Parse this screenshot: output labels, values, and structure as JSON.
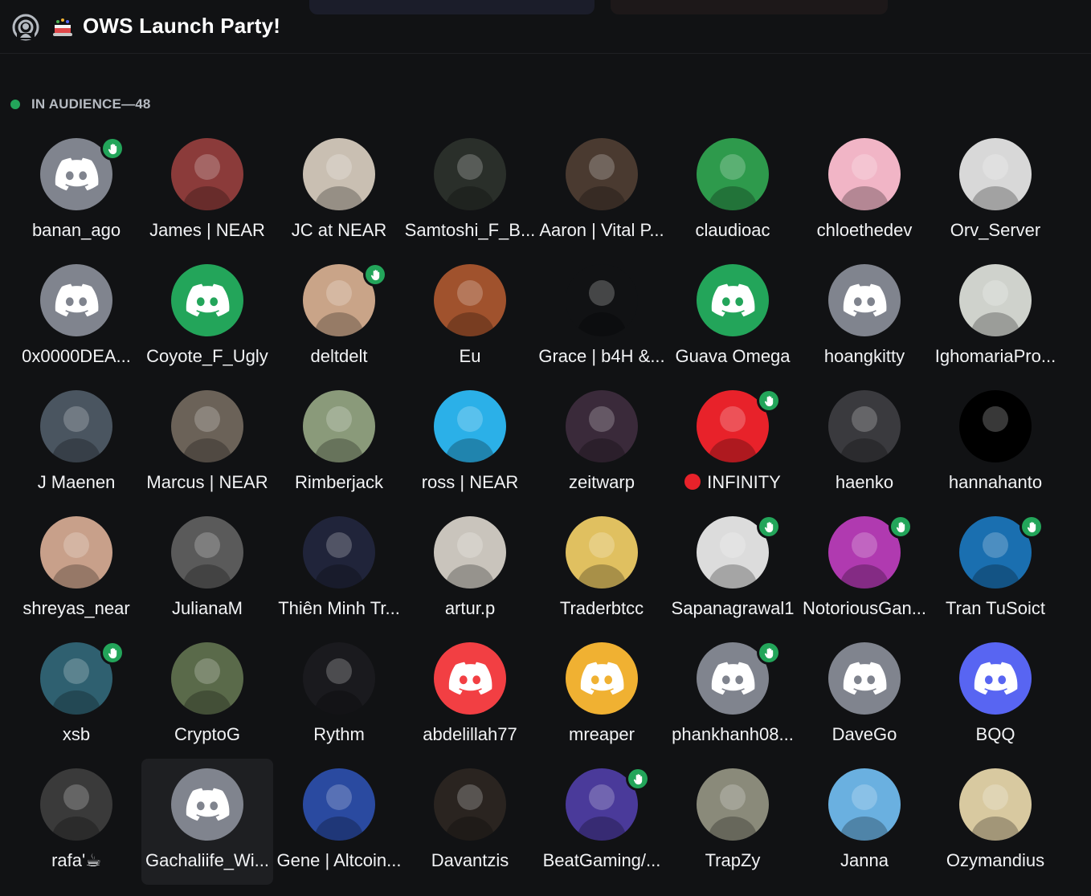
{
  "header": {
    "title": "OWS Launch Party!",
    "stage_icon": "stage-channel-icon",
    "party_icon": "party-cake-icon"
  },
  "section": {
    "label": "IN AUDIENCE—48",
    "status_color": "#23a55a"
  },
  "members": [
    {
      "name": "banan_ago",
      "avatar": "discord-default",
      "color": "#80848e",
      "hand": true
    },
    {
      "name": "James | NEAR",
      "avatar": "photo",
      "color": "#8b3b3a",
      "hand": false
    },
    {
      "name": "JC at NEAR",
      "avatar": "photo",
      "color": "#c9bfb2",
      "hand": false
    },
    {
      "name": "Samtoshi_F_B...",
      "avatar": "photo",
      "color": "#2a2f2a",
      "hand": false
    },
    {
      "name": "Aaron | Vital P...",
      "avatar": "photo",
      "color": "#4a3a30",
      "hand": false
    },
    {
      "name": "claudioac",
      "avatar": "photo",
      "color": "#2e9a4c",
      "hand": false
    },
    {
      "name": "chloethedev",
      "avatar": "photo",
      "color": "#f1b5c6",
      "hand": false
    },
    {
      "name": "Orv_Server",
      "avatar": "photo",
      "color": "#d8d8d8",
      "hand": false
    },
    {
      "name": "0x0000DEA...",
      "avatar": "discord-default",
      "color": "#80848e",
      "hand": false
    },
    {
      "name": "Coyote_F_Ugly",
      "avatar": "discord-default",
      "color": "#23a55a",
      "hand": false
    },
    {
      "name": "deltdelt",
      "avatar": "photo",
      "color": "#c9a488",
      "hand": true
    },
    {
      "name": "Eu",
      "avatar": "photo",
      "color": "#a0522d",
      "hand": false
    },
    {
      "name": "Grace | b4H &...",
      "avatar": "photo",
      "color": "#111214",
      "hand": false
    },
    {
      "name": "Guava Omega",
      "avatar": "discord-default",
      "color": "#23a55a",
      "hand": false
    },
    {
      "name": "hoangkitty",
      "avatar": "discord-default",
      "color": "#80848e",
      "hand": false
    },
    {
      "name": "IghomariaPro...",
      "avatar": "photo",
      "color": "#cfd2cc",
      "hand": false
    },
    {
      "name": "J Maenen",
      "avatar": "photo",
      "color": "#4a5560",
      "hand": false
    },
    {
      "name": "Marcus | NEAR",
      "avatar": "photo",
      "color": "#6b6258",
      "hand": false
    },
    {
      "name": "Rimberjack",
      "avatar": "photo",
      "color": "#8a9a7a",
      "hand": false
    },
    {
      "name": "ross | NEAR",
      "avatar": "photo",
      "color": "#2bb0e8",
      "hand": false
    },
    {
      "name": "zeitwarp",
      "avatar": "photo",
      "color": "#3a2a3a",
      "hand": false
    },
    {
      "name": "INFINITY",
      "avatar": "photo",
      "color": "#e8222a",
      "hand": true,
      "prefix_dot": true
    },
    {
      "name": "haenko",
      "avatar": "photo",
      "color": "#3a3a3e",
      "hand": false
    },
    {
      "name": "hannahanto",
      "avatar": "photo",
      "color": "#000000",
      "hand": false
    },
    {
      "name": "shreyas_near",
      "avatar": "photo",
      "color": "#c8a08a",
      "hand": false
    },
    {
      "name": "JulianaM",
      "avatar": "photo",
      "color": "#5a5a5a",
      "hand": false
    },
    {
      "name": "Thiên Minh Tr...",
      "avatar": "photo",
      "color": "#20243a",
      "hand": false
    },
    {
      "name": "artur.p",
      "avatar": "photo",
      "color": "#c9c4bc",
      "hand": false
    },
    {
      "name": "Traderbtcc",
      "avatar": "photo",
      "color": "#e0c060",
      "hand": false
    },
    {
      "name": "Sapanagrawal1",
      "avatar": "photo",
      "color": "#dcdcdc",
      "hand": true
    },
    {
      "name": "NotoriousGan...",
      "avatar": "photo",
      "color": "#b03ab0",
      "hand": true
    },
    {
      "name": "Tran TuSoict",
      "avatar": "photo",
      "color": "#1a6fb0",
      "hand": true
    },
    {
      "name": "xsb",
      "avatar": "photo",
      "color": "#2f6070",
      "hand": true
    },
    {
      "name": "CryptoG",
      "avatar": "photo",
      "color": "#5a6a4a",
      "hand": false
    },
    {
      "name": "Rythm",
      "avatar": "photo",
      "color": "#1a1a1e",
      "hand": false
    },
    {
      "name": "abdelillah77",
      "avatar": "discord-default",
      "color": "#f23f43",
      "hand": false
    },
    {
      "name": "mreaper",
      "avatar": "discord-default",
      "color": "#f0b132",
      "hand": false
    },
    {
      "name": "phankhanh08...",
      "avatar": "discord-default",
      "color": "#80848e",
      "hand": true
    },
    {
      "name": "DaveGo",
      "avatar": "discord-default",
      "color": "#80848e",
      "hand": false
    },
    {
      "name": "BQQ",
      "avatar": "discord-default",
      "color": "#5865f2",
      "hand": false
    },
    {
      "name": "rafa'☕",
      "avatar": "photo",
      "color": "#3a3a3a",
      "hand": false
    },
    {
      "name": "Gachaliife_Wi...",
      "avatar": "discord-default",
      "color": "#80848e",
      "hand": false,
      "hover": true
    },
    {
      "name": "Gene | Altcoin...",
      "avatar": "photo",
      "color": "#2a4aa0",
      "hand": false
    },
    {
      "name": "Davantzis",
      "avatar": "photo",
      "color": "#2a2420",
      "hand": false
    },
    {
      "name": "BeatGaming/...",
      "avatar": "photo",
      "color": "#4a3a9a",
      "hand": true
    },
    {
      "name": "TrapZy",
      "avatar": "photo",
      "color": "#8a8a7a",
      "hand": false
    },
    {
      "name": "Janna",
      "avatar": "photo",
      "color": "#6ab0e0",
      "hand": false
    },
    {
      "name": "Ozymandius",
      "avatar": "photo",
      "color": "#d8c9a0",
      "hand": false
    }
  ]
}
